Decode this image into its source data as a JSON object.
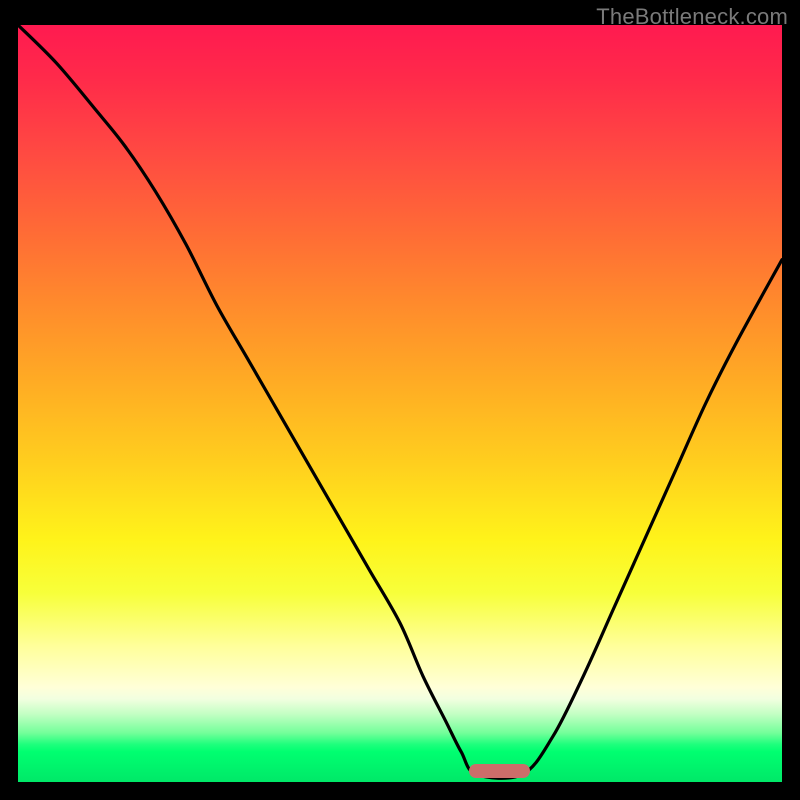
{
  "watermark": "TheBottleneck.com",
  "colors": {
    "frame": "#000000",
    "curve": "#000000",
    "marker": "#cc6d6a",
    "watermark": "#7a7a7a",
    "gradient_top": "#ff1a50",
    "gradient_bottom": "#00e868"
  },
  "chart_data": {
    "type": "line",
    "title": "",
    "xlabel": "",
    "ylabel": "",
    "xlim": [
      0,
      100
    ],
    "ylim": [
      0,
      100
    ],
    "grid": false,
    "legend": false,
    "series": [
      {
        "name": "bottleneck-curve",
        "x": [
          0,
          5,
          10,
          14,
          18,
          22,
          26,
          30,
          34,
          38,
          42,
          46,
          50,
          53,
          56,
          58,
          60,
          66,
          70,
          74,
          78,
          82,
          86,
          90,
          94,
          100
        ],
        "values": [
          100,
          95,
          89,
          84,
          78,
          71,
          63,
          56,
          49,
          42,
          35,
          28,
          21,
          14,
          8,
          4,
          1,
          1,
          6,
          14,
          23,
          32,
          41,
          50,
          58,
          69
        ]
      }
    ],
    "annotations": [
      {
        "name": "optimal-marker",
        "x": 63,
        "y": 0,
        "width": 8,
        "color": "#cc6d6a"
      }
    ]
  }
}
